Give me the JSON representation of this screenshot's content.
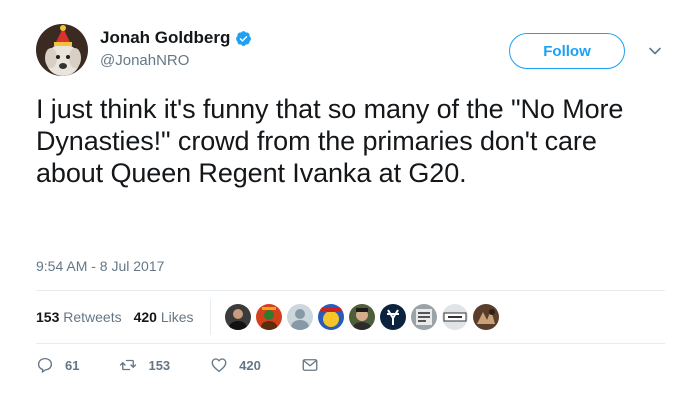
{
  "author": {
    "display_name": "Jonah Goldberg",
    "handle": "@JonahNRO",
    "verified": true,
    "avatar_icon": "dog-with-party-hat-avatar"
  },
  "header": {
    "follow_label": "Follow",
    "menu_icon": "chevron-down-icon"
  },
  "tweet": {
    "text": "I just think it's funny that so many of the \"No More Dynasties!\" crowd from the primaries don't care about Queen Regent Ivanka at G20.",
    "timestamp": "9:54 AM - 8 Jul 2017"
  },
  "stats": {
    "retweets_count": "153",
    "retweets_label": "Retweets",
    "likes_count": "420",
    "likes_label": "Likes"
  },
  "likers": [
    {
      "icon": "person-avatar"
    },
    {
      "icon": "costume-avatar"
    },
    {
      "icon": "default-egg-avatar"
    },
    {
      "icon": "cartoon-avatar"
    },
    {
      "icon": "person-avatar"
    },
    {
      "icon": "yankees-logo-avatar"
    },
    {
      "icon": "document-avatar"
    },
    {
      "icon": "think-sign-avatar"
    },
    {
      "icon": "artwork-avatar"
    }
  ],
  "actions": {
    "reply_count": "61",
    "retweet_count": "153",
    "like_count": "420"
  },
  "colors": {
    "accent": "#1da1f2",
    "secondary_text": "#657786",
    "primary_text": "#14171a",
    "divider": "#e6ecf0"
  }
}
